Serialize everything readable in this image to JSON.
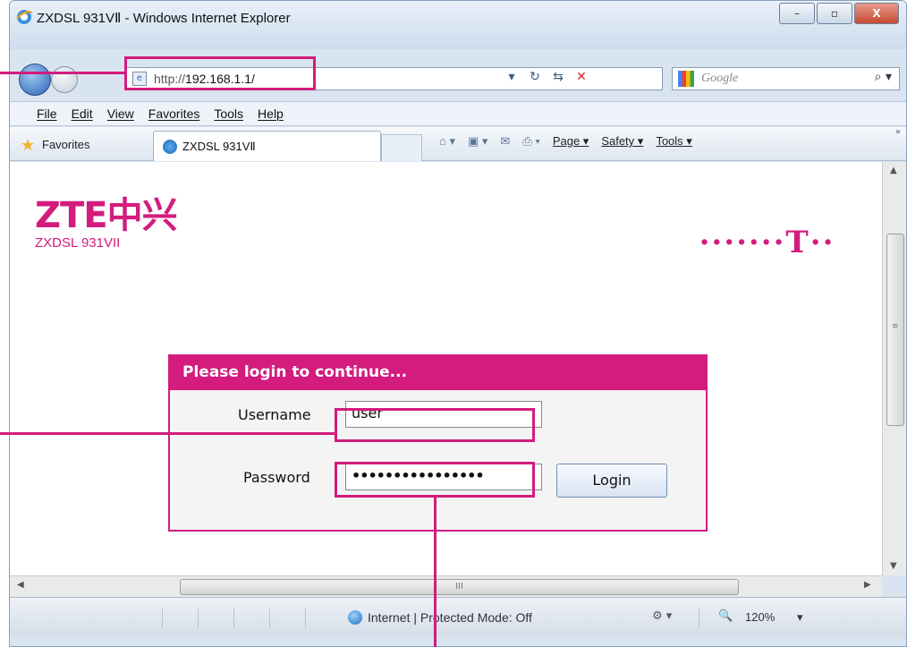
{
  "window": {
    "title": "ZXDSL 931VⅡ - Windows Internet Explorer",
    "controls": {
      "minimize": "–",
      "maximize": "▫",
      "close": "X"
    }
  },
  "address_bar": {
    "prefix": "http://",
    "host": "192.168.1.1/",
    "refresh": "↻",
    "compat": "⇆",
    "stop": "✕"
  },
  "search": {
    "placeholder": "Google",
    "button": "⌕ ▾"
  },
  "menu": [
    "File",
    "Edit",
    "View",
    "Favorites",
    "Tools",
    "Help"
  ],
  "favorites_bar": {
    "favorites_label": "Favorites",
    "tab_label": "ZXDSL 931VⅡ",
    "commands": [
      "Page ▾",
      "Safety ▾",
      "Tools ▾"
    ],
    "home": "⌂ ▾",
    "feeds": "▣ ▾",
    "mail": "✉",
    "print": "⎙ ▾",
    "more": "»"
  },
  "page": {
    "brand_mark": "ZTE中兴",
    "brand_model": "ZXDSL 931VII",
    "partner_logo": "·······T··",
    "login": {
      "heading": "Please login to continue...",
      "username_label": "Username",
      "username_value": "user",
      "password_label": "Password",
      "password_value": "••••••••••••••••",
      "button": "Login"
    }
  },
  "scrollbars": {
    "h_thumb_grip": "III",
    "up": "▲",
    "down": "▼",
    "left": "◀",
    "right": "▶",
    "v_grip": "≡"
  },
  "status_bar": {
    "zone_text": "Internet | Protected Mode: Off",
    "zoom": "120%",
    "zoom_dropdown": "▾",
    "security_icon": "⚙ ▾"
  },
  "colors": {
    "accent": "#d31c7d",
    "chrome": "#d9e4f1"
  }
}
